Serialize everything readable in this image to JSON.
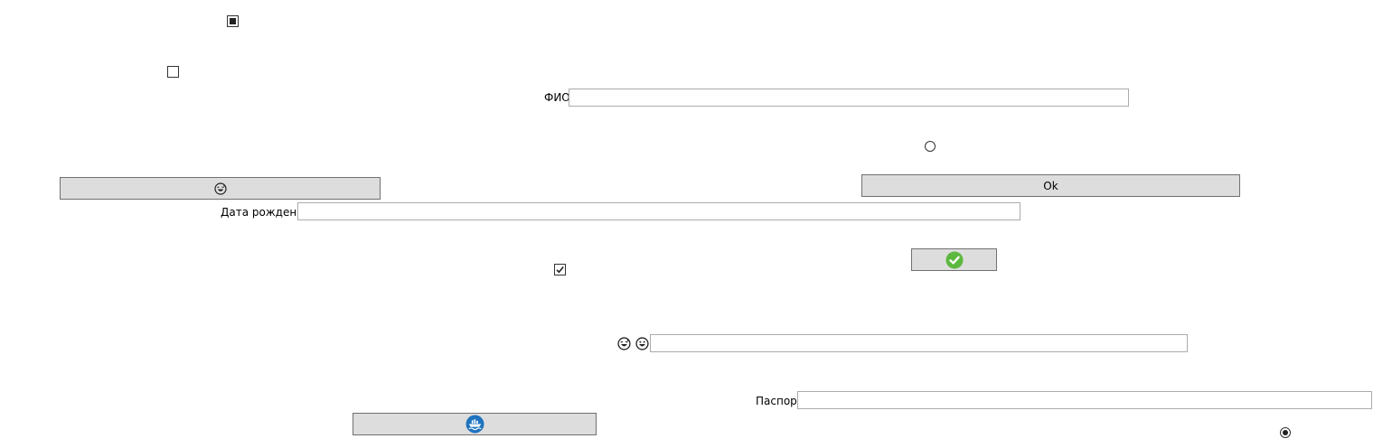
{
  "form": {
    "fio_label": "ФИО",
    "fio_value": "",
    "birthdate_label": "Дата рождения",
    "birthdate_value": "",
    "passport_label": "Паспорт",
    "passport_value": "",
    "emoji_field_value": "",
    "ok_button_label": "Ok"
  },
  "controls": {
    "checkbox_indeterminate": "indeterminate",
    "checkbox_unchecked": "unchecked",
    "checkbox_checked": "checked",
    "radio_unchecked": "unchecked",
    "radio_checked": "checked"
  },
  "icons": {
    "emoji_button_icon": "grinning-sweat-face-icon",
    "check_button_icon": "green-check-circle-icon",
    "ship_button_icon": "blue-ship-circle-icon",
    "label_icon_1": "grinning-sweat-face-icon",
    "label_icon_2": "grinning-face-icon"
  },
  "colors": {
    "button_bg": "#dddddd",
    "button_border": "#707070",
    "textbox_border": "#ababab",
    "check_green": "#5cb83f",
    "ship_blue": "#1e73be"
  }
}
